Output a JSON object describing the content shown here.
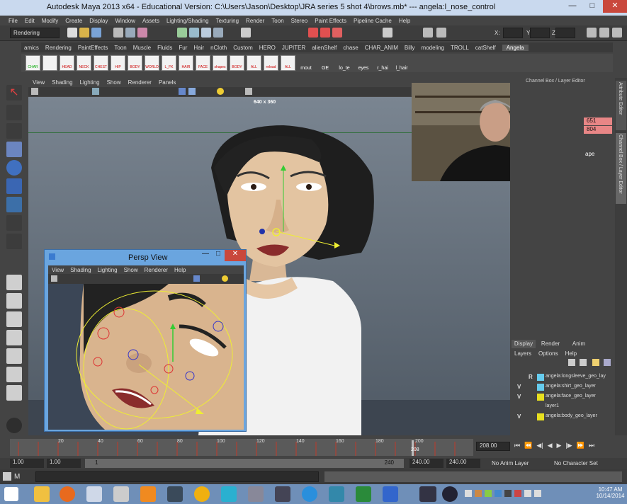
{
  "window": {
    "title": "Autodesk Maya 2013 x64 - Educational Version: C:\\Users\\Jason\\Desktop\\JRA series 5 shot 4\\brows.mb*   ---   angela:l_nose_control",
    "minimize": "—",
    "maximize": "□",
    "close": "✕"
  },
  "menu": [
    "File",
    "Edit",
    "Modify",
    "Create",
    "Display",
    "Window",
    "Assets",
    "Lighting/Shading",
    "Texturing",
    "Render",
    "Toon",
    "Stereo",
    "Paint Effects",
    "Pipeline Cache",
    "Help"
  ],
  "statusline": {
    "menuset": "Rendering",
    "x_label": "X:",
    "y_label": "Y:",
    "z_label": "Z:"
  },
  "shelf_tabs": [
    "amics",
    "Rendering",
    "PaintEffects",
    "Toon",
    "Muscle",
    "Fluids",
    "Fur",
    "Hair",
    "nCloth",
    "Custom",
    "HERO",
    "JUPITER",
    "alienShelf",
    "chase",
    "CHAR_ANIM",
    "Billy",
    "modeling",
    "TROLL",
    "catShelf",
    "Angela"
  ],
  "shelf_buttons": [
    "CHAR",
    "",
    "HEAD",
    "NECK",
    "CHEST",
    "HIP",
    "BODY",
    "WORLD",
    "L_FK",
    "HAIR",
    "FACE",
    "shapes",
    "BODY",
    "ALL",
    "reload",
    "ALL"
  ],
  "shelf_text": [
    "mout",
    "GE",
    "lo_te",
    "eyes",
    "r_hai",
    "l_hair"
  ],
  "viewport": {
    "menu": [
      "View",
      "Shading",
      "Lighting",
      "Show",
      "Renderer",
      "Panels"
    ],
    "resolution": "640 x 360"
  },
  "channel_box": {
    "header": "Channel Box / Layer Editor",
    "values": [
      "651",
      "804"
    ],
    "label": "ape"
  },
  "layer_editor": {
    "tabs": [
      "Display",
      "Render",
      "Anim"
    ],
    "menu": [
      "Layers",
      "Options",
      "Help"
    ],
    "layers": [
      {
        "v": "",
        "r": "R",
        "color": "#66ccee",
        "name": "angela:longsleeve_geo_lay"
      },
      {
        "v": "V",
        "r": "",
        "color": "#66ccee",
        "name": "angela:shirt_geo_layer"
      },
      {
        "v": "V",
        "r": "",
        "color": "#e8e020",
        "name": "angela:face_geo_layer"
      },
      {
        "v": "",
        "r": "",
        "color": "",
        "name": "layer1"
      },
      {
        "v": "V",
        "r": "",
        "color": "#e8e020",
        "name": "angela:body_geo_layer"
      }
    ]
  },
  "vertical_tabs": [
    "Attribute Editor",
    "Channel Box / Layer Editor"
  ],
  "persp": {
    "title": "Persp View",
    "menu": [
      "View",
      "Shading",
      "Lighting",
      "Show",
      "Renderer",
      "Help"
    ]
  },
  "timeline": {
    "ticks": [
      "20",
      "40",
      "60",
      "80",
      "100",
      "120",
      "140",
      "160",
      "180",
      "200"
    ],
    "current": "208",
    "field": "208.00"
  },
  "range": {
    "start": "1.00",
    "start2": "1.00",
    "slider_start": "1",
    "slider_end": "240",
    "end": "240.00",
    "end2": "240.00",
    "anim_layer": "No Anim Layer",
    "char_set": "No Character Set"
  },
  "cmd": {
    "label": "M"
  },
  "taskbar": {
    "time": "10:47 AM",
    "date": "10/14/2014"
  }
}
